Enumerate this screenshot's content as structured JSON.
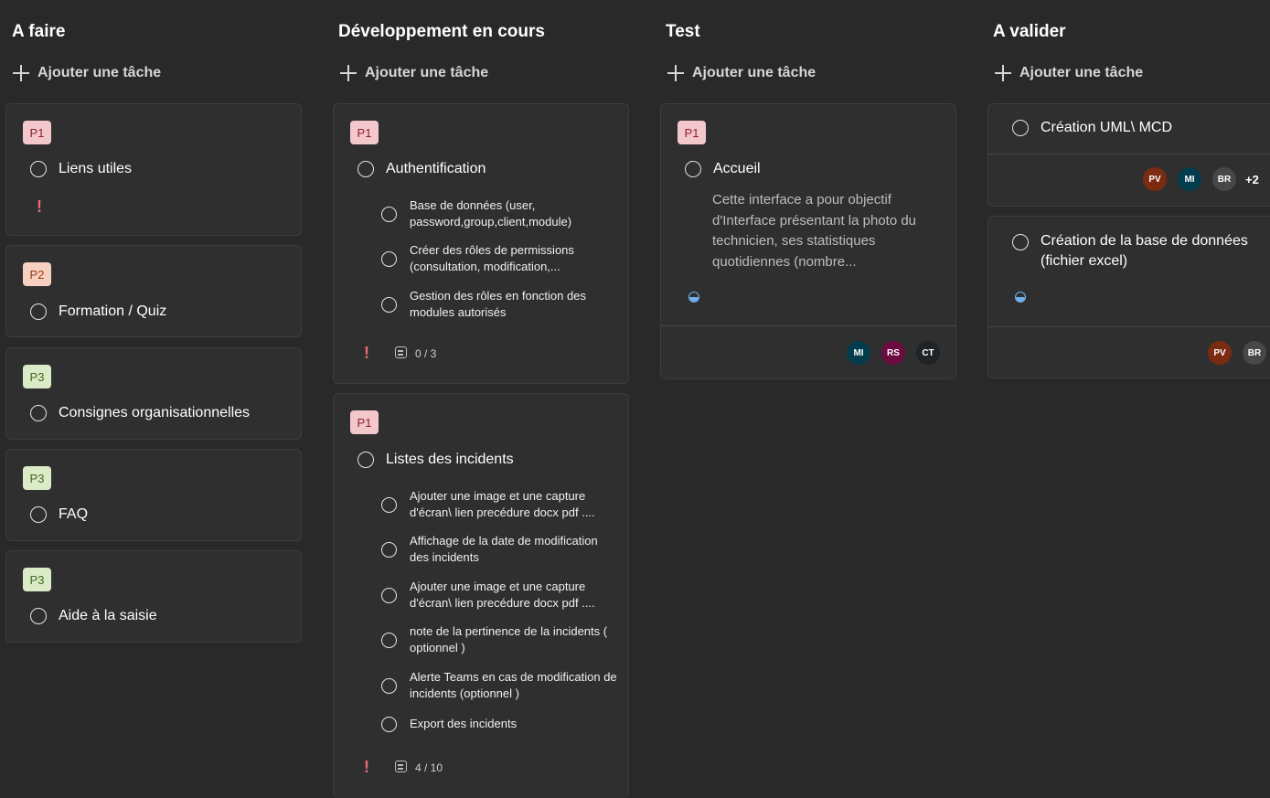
{
  "columns": [
    {
      "title": "A faire",
      "add_label": "Ajouter une tâche",
      "cards": [
        {
          "priority": "P1",
          "title": "Liens utiles"
        },
        {
          "priority": "P2",
          "title": "Formation / Quiz"
        },
        {
          "priority": "P3",
          "title": "Consignes organisationnelles"
        },
        {
          "priority": "P3",
          "title": "FAQ"
        },
        {
          "priority": "P3",
          "title": "Aide à la saisie"
        }
      ]
    },
    {
      "title": "Développement en cours",
      "add_label": "Ajouter une tâche",
      "cards": [
        {
          "priority": "P1",
          "title": "Authentification",
          "subtasks": [
            "Base de données (user, password,group,client,module)",
            "Créer des rôles de permissions (consultation, modification,...",
            "Gestion des rôles en fonction des modules autorisés"
          ],
          "checklist": "0 / 3"
        },
        {
          "priority": "P1",
          "title": "Listes des incidents",
          "subtasks": [
            "Ajouter une image et une capture d'écran\\ lien precédure docx pdf ....",
            "Affichage de la date de modification des incidents",
            "Ajouter une image et une capture d'écran\\ lien precédure docx pdf ....",
            "note de la pertinence de la incidents ( optionnel )",
            "Alerte Teams en cas de modification de incidents (optionnel )",
            "Export des incidents"
          ],
          "checklist": "4 / 10"
        }
      ]
    },
    {
      "title": "Test",
      "add_label": "Ajouter une tâche",
      "cards": [
        {
          "priority": "P1",
          "title": "Accueil",
          "description": "Cette interface a pour objectif d'Interface présentant la photo du technicien, ses statistiques quotidiennes (nombre...",
          "progress": 0.5,
          "assignees": [
            "MI",
            "RS",
            "CT"
          ]
        }
      ]
    },
    {
      "title": "A valider",
      "add_label": "Ajouter une tâche",
      "cards": [
        {
          "title": "Création UML\\ MCD",
          "assignees": [
            "PV",
            "MI",
            "BR"
          ],
          "more_assignees": "+2"
        },
        {
          "title": "Création de la base de données (fichier excel)",
          "progress": 0.5,
          "assignees": [
            "PV",
            "BR"
          ]
        }
      ]
    }
  ]
}
